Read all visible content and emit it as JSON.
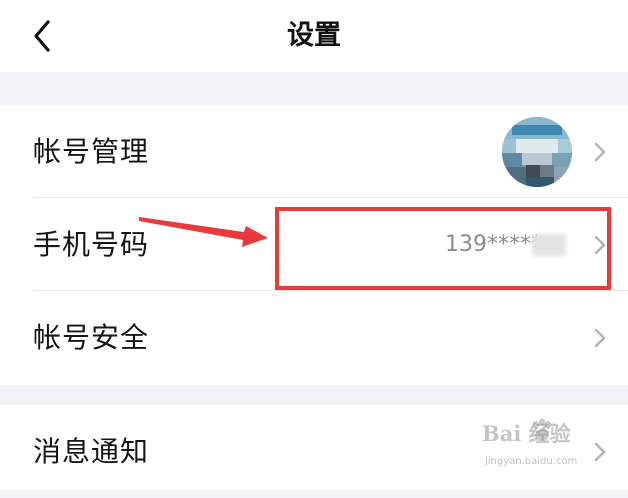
{
  "header": {
    "title": "设置"
  },
  "groups": [
    {
      "rows": [
        {
          "label": "帐号管理",
          "accessory": "avatar"
        },
        {
          "label": "手机号码",
          "value": "139*****"
        },
        {
          "label": "帐号安全"
        }
      ]
    },
    {
      "rows": [
        {
          "label": "消息通知"
        }
      ]
    }
  ],
  "annotation": {
    "arrow_color": "#e63b3b",
    "box_color": "#e63b3b"
  },
  "watermark": {
    "brand": "Bai  经验",
    "url": "jingyan.baidu.com"
  },
  "colors": {
    "background": "#f2f2f7",
    "surface": "#ffffff",
    "secondary_text": "#8c8c8c",
    "accent_red": "#e63b3b"
  },
  "icons": [
    "back-chevron-icon",
    "chevron-right-icon",
    "baidu-paw-icon"
  ]
}
